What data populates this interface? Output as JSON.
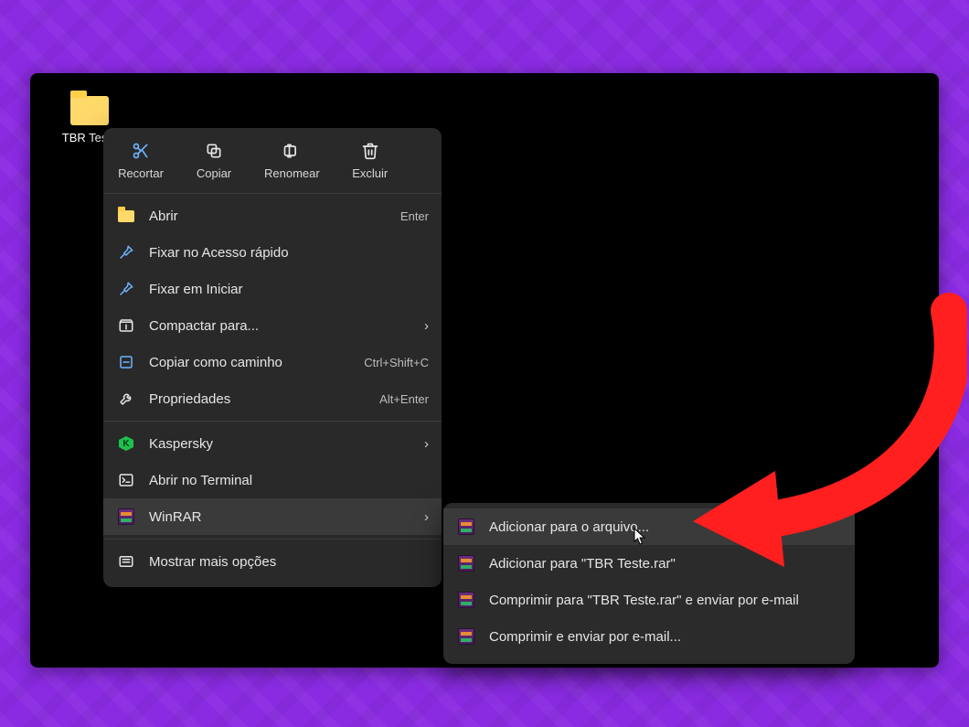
{
  "desktop": {
    "folder_label": "TBR Teste"
  },
  "context_menu": {
    "toolbar": {
      "cut": {
        "label": "Recortar"
      },
      "copy": {
        "label": "Copiar"
      },
      "rename": {
        "label": "Renomear"
      },
      "delete": {
        "label": "Excluir"
      }
    },
    "items": {
      "open": {
        "label": "Abrir",
        "shortcut": "Enter"
      },
      "pin_quick": {
        "label": "Fixar no Acesso rápido"
      },
      "pin_start": {
        "label": "Fixar em Iniciar"
      },
      "compress_to": {
        "label": "Compactar para..."
      },
      "copy_path": {
        "label": "Copiar como caminho",
        "shortcut": "Ctrl+Shift+C"
      },
      "properties": {
        "label": "Propriedades",
        "shortcut": "Alt+Enter"
      },
      "kaspersky": {
        "label": "Kaspersky"
      },
      "open_terminal": {
        "label": "Abrir no Terminal"
      },
      "winrar": {
        "label": "WinRAR"
      },
      "more": {
        "label": "Mostrar mais opções"
      }
    }
  },
  "winrar_submenu": {
    "add_to_archive": {
      "label": "Adicionar para o arquivo..."
    },
    "add_to_named": {
      "label": "Adicionar para \"TBR Teste.rar\""
    },
    "compress_email_named": {
      "label": "Comprimir para \"TBR Teste.rar\" e enviar por e-mail"
    },
    "compress_email": {
      "label": "Comprimir e enviar por e-mail..."
    }
  }
}
